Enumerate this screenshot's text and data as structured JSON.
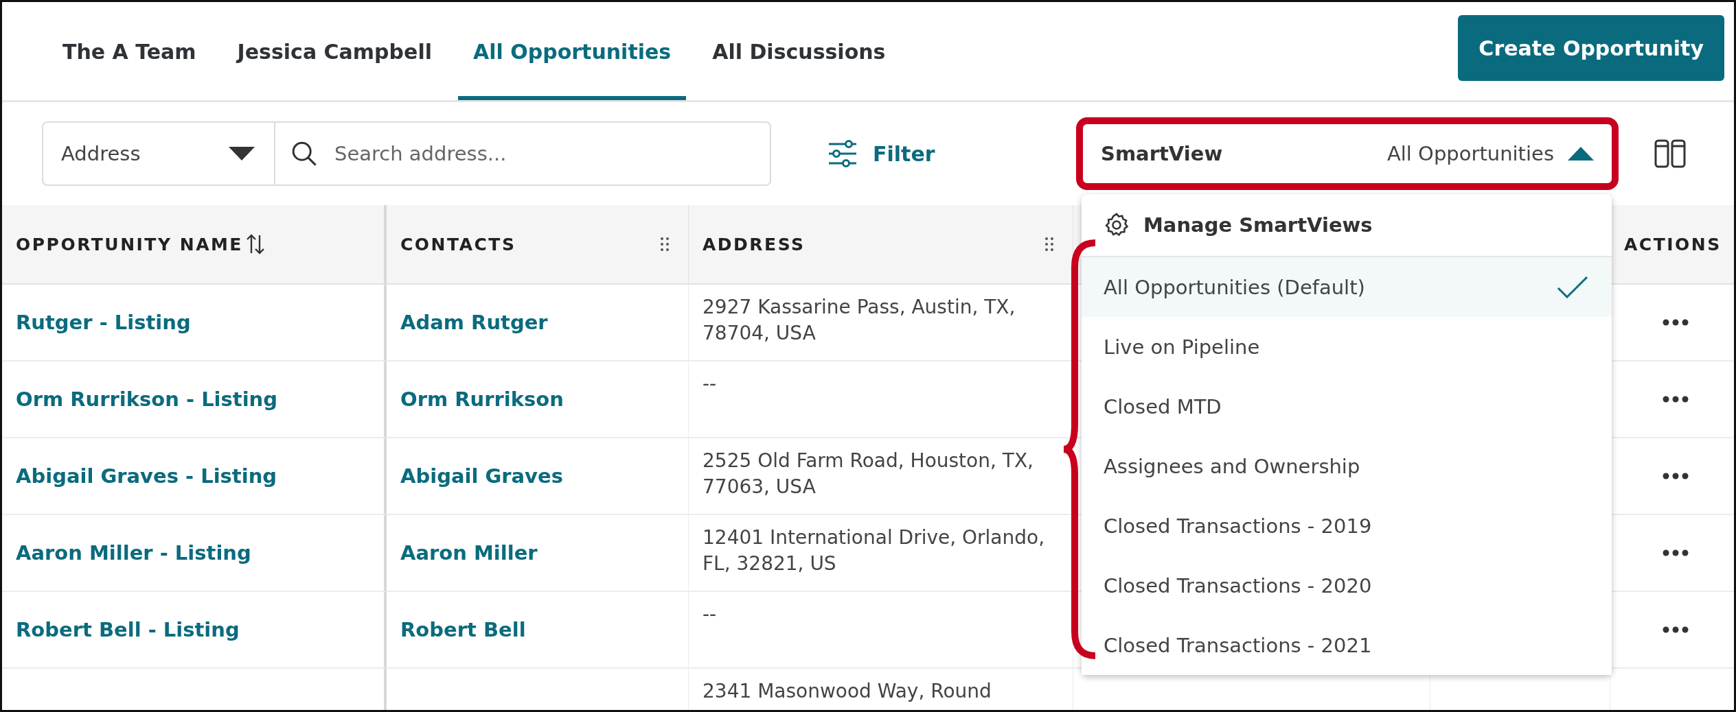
{
  "tabs": [
    {
      "label": "The A Team",
      "selected": false
    },
    {
      "label": "Jessica Campbell",
      "selected": false
    },
    {
      "label": "All Opportunities",
      "selected": true
    },
    {
      "label": "All Discussions",
      "selected": false
    }
  ],
  "create_button": "Create Opportunity",
  "search": {
    "field": "Address",
    "placeholder": "Search address..."
  },
  "filter_button": "Filter",
  "smartview": {
    "label": "SmartView",
    "value": "All Opportunities",
    "expanded": true,
    "annotated": true
  },
  "smartview_menu": {
    "manage": "Manage SmartViews",
    "bracketed": true,
    "items": [
      {
        "label": "All Opportunities (Default)",
        "selected": true
      },
      {
        "label": "Live on Pipeline",
        "selected": false
      },
      {
        "label": "Closed MTD",
        "selected": false
      },
      {
        "label": "Assignees and Ownership",
        "selected": false
      },
      {
        "label": "Closed Transactions - 2019",
        "selected": false
      },
      {
        "label": "Closed Transactions - 2020",
        "selected": false
      },
      {
        "label": "Closed Transactions - 2021",
        "selected": false
      }
    ]
  },
  "table": {
    "columns": [
      {
        "label": "OPPORTUNITY NAME",
        "kind": "sortable"
      },
      {
        "label": "CONTACTS",
        "kind": "draggable"
      },
      {
        "label": "ADDRESS",
        "kind": "draggable"
      },
      {
        "label": "ACTIONS",
        "kind": "plain"
      }
    ],
    "rows": [
      {
        "name": "Rutger - Listing",
        "contact": "Adam Rutger",
        "address": "2927 Kassarine Pass, Austin, TX, 78704, USA"
      },
      {
        "name": "Orm Rurrikson - Listing",
        "contact": "Orm Rurrikson",
        "address": "--"
      },
      {
        "name": "Abigail Graves - Listing",
        "contact": "Abigail Graves",
        "address": "2525 Old Farm Road, Houston, TX, 77063, USA"
      },
      {
        "name": "Aaron Miller - Listing",
        "contact": "Aaron Miller",
        "address": "12401 International Drive, Orlando, FL, 32821, US"
      },
      {
        "name": "Robert Bell - Listing",
        "contact": "Robert Bell",
        "address": "--"
      },
      {
        "address": "2341 Masonwood Way, Round"
      }
    ]
  }
}
